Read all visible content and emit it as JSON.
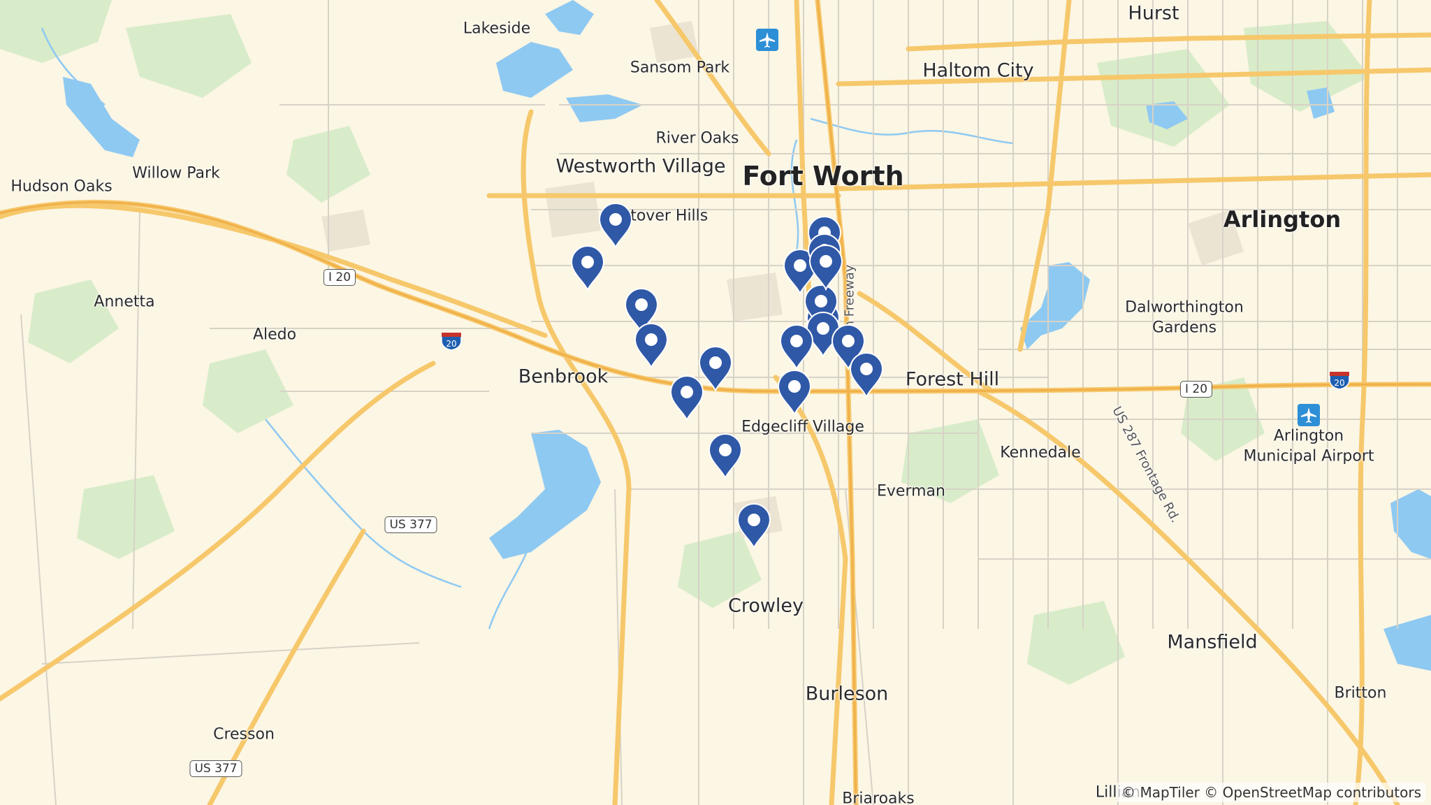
{
  "map": {
    "colors": {
      "land": "#fcf6e4",
      "water": "#8ec9f2",
      "major_road": "#f6c86b",
      "minor_road": "#d7d2c6",
      "park": "#d8ecc9",
      "urban": "#ebe4d3",
      "pin": "#2f58a6"
    },
    "labels": [
      {
        "id": "fort-worth",
        "text": "Fort Worth",
        "size": "city-xl"
      },
      {
        "id": "arlington",
        "text": "Arlington",
        "size": "city-l"
      },
      {
        "id": "haltom-city",
        "text": "Haltom City",
        "size": "city-m"
      },
      {
        "id": "hurst",
        "text": "Hurst",
        "size": "city-m"
      },
      {
        "id": "westworth-village",
        "text": "Westworth Village",
        "size": "city-m"
      },
      {
        "id": "benbrook",
        "text": "Benbrook",
        "size": "city-m"
      },
      {
        "id": "forest-hill",
        "text": "Forest Hill",
        "size": "city-m"
      },
      {
        "id": "crowley",
        "text": "Crowley",
        "size": "city-m"
      },
      {
        "id": "burleson",
        "text": "Burleson",
        "size": "city-m"
      },
      {
        "id": "mansfield",
        "text": "Mansfield",
        "size": "city-m"
      },
      {
        "id": "lakeside",
        "text": "Lakeside",
        "size": "city-s"
      },
      {
        "id": "sansom-park",
        "text": "Sansom Park",
        "size": "city-s"
      },
      {
        "id": "river-oaks",
        "text": "River Oaks",
        "size": "city-s"
      },
      {
        "id": "willow-park",
        "text": "Willow Park",
        "size": "city-s"
      },
      {
        "id": "hudson-oaks",
        "text": "Hudson Oaks",
        "size": "city-s"
      },
      {
        "id": "westover-hills",
        "text": "stover Hills",
        "size": "city-s"
      },
      {
        "id": "annetta",
        "text": "Annetta",
        "size": "city-s"
      },
      {
        "id": "aledo",
        "text": "Aledo",
        "size": "city-s"
      },
      {
        "id": "edgecliff-village",
        "text": "Edgecliff Village",
        "size": "city-s"
      },
      {
        "id": "everman",
        "text": "Everman",
        "size": "city-s"
      },
      {
        "id": "kennedale",
        "text": "Kennedale",
        "size": "city-s"
      },
      {
        "id": "dalworthington-gardens-1",
        "text": "Dalworthington",
        "size": "city-s"
      },
      {
        "id": "dalworthington-gardens-2",
        "text": "Gardens",
        "size": "city-s"
      },
      {
        "id": "arlington-airport-1",
        "text": "Arlington",
        "size": "city-s"
      },
      {
        "id": "arlington-airport-2",
        "text": "Municipal Airport",
        "size": "city-s"
      },
      {
        "id": "cresson",
        "text": "Cresson",
        "size": "city-s"
      },
      {
        "id": "britton",
        "text": "Britton",
        "size": "city-s"
      },
      {
        "id": "lillian",
        "text": "Lillian",
        "size": "city-s"
      },
      {
        "id": "briaroaks",
        "text": "Briaroaks",
        "size": "city-s"
      },
      {
        "id": "us287-frontage",
        "text": "US 287 Frontage Rd.",
        "size": "road"
      },
      {
        "id": "south-freeway",
        "text": "South Freeway",
        "size": "road"
      }
    ],
    "shields": [
      {
        "id": "i20-west",
        "text": "I 20"
      },
      {
        "id": "i20-east",
        "text": "I 20"
      },
      {
        "id": "us377-north",
        "text": "US 377"
      },
      {
        "id": "us377-south",
        "text": "US 377"
      }
    ],
    "interstate_badges": [
      {
        "id": "i20-badge-west",
        "text": "20"
      },
      {
        "id": "i20-badge-east",
        "text": "20"
      }
    ],
    "pin_count": 19,
    "attribution": "© MapTiler © OpenStreetMap contributors"
  }
}
